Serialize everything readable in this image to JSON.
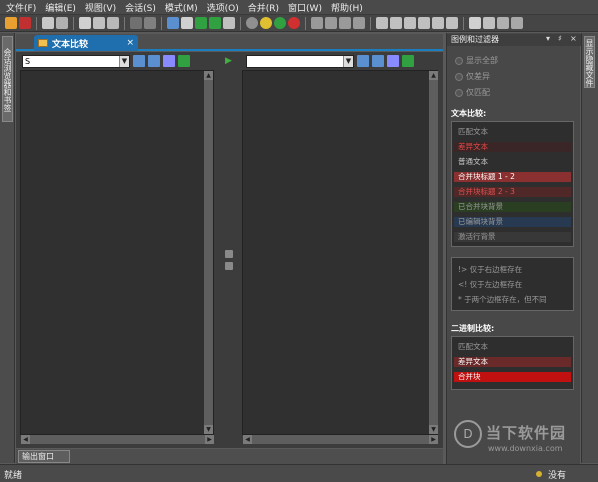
{
  "menu": [
    "文件(F)",
    "编辑(E)",
    "视图(V)",
    "会话(S)",
    "模式(M)",
    "选项(O)",
    "合并(R)",
    "窗口(W)",
    "帮助(H)"
  ],
  "left_tab": "会话浏览器和书签",
  "right_tab": "显示隐藏文件",
  "document_tab": {
    "title": "文本比较",
    "close": "×"
  },
  "left_combo": {
    "value": "S"
  },
  "right_combo": {
    "value": ""
  },
  "output_tab": "输出窗口",
  "status": {
    "left": "就绪",
    "right": "没有"
  },
  "right_panel": {
    "title": "图例和过滤器",
    "controls": [
      "▾",
      "♯",
      "×"
    ],
    "radios": [
      "显示全部",
      "仅差异",
      "仅匹配"
    ],
    "text_section": "文本比较:",
    "text_items": [
      {
        "label": "匹配文本",
        "bg": "#2e2e2e",
        "fg": "#9a9a9a"
      },
      {
        "label": "差异文本",
        "bg": "#3a2626",
        "fg": "#e84848"
      },
      {
        "label": "普通文本",
        "bg": "#2e2e2e",
        "fg": "#c8c8c8"
      },
      {
        "label": "合并块标题 1 - 2",
        "bg": "#8a3030",
        "fg": "#ffffff"
      },
      {
        "label": "合并块标题 2 - 3",
        "bg": "#502828",
        "fg": "#e05050"
      },
      {
        "label": "已合并块背景",
        "bg": "#2a3e22",
        "fg": "#9a9a9a"
      },
      {
        "label": "已编辑块背景",
        "bg": "#283a52",
        "fg": "#9a9a9a"
      },
      {
        "label": "激活行背景",
        "bg": "#383838",
        "fg": "#9a9a9a"
      }
    ],
    "legend": [
      "!> 仅于右边框存在",
      "<! 仅于左边框存在",
      "* 于两个边框存在，但不同"
    ],
    "binary_section": "二进制比较:",
    "binary_items": [
      {
        "label": "匹配文本",
        "bg": "#2e2e2e",
        "fg": "#9a9a9a"
      },
      {
        "label": "差异文本",
        "bg": "#6a2a2a",
        "fg": "#ffffff"
      },
      {
        "label": "合并块",
        "bg": "#c01010",
        "fg": "#ffffff"
      }
    ]
  },
  "watermark": {
    "icon": "D",
    "title": "当下软件园",
    "url": "www.downxia.com"
  },
  "colors": {
    "accent": "#1f6fae",
    "pane_bg": "#303030",
    "panel_bg": "#484848"
  }
}
